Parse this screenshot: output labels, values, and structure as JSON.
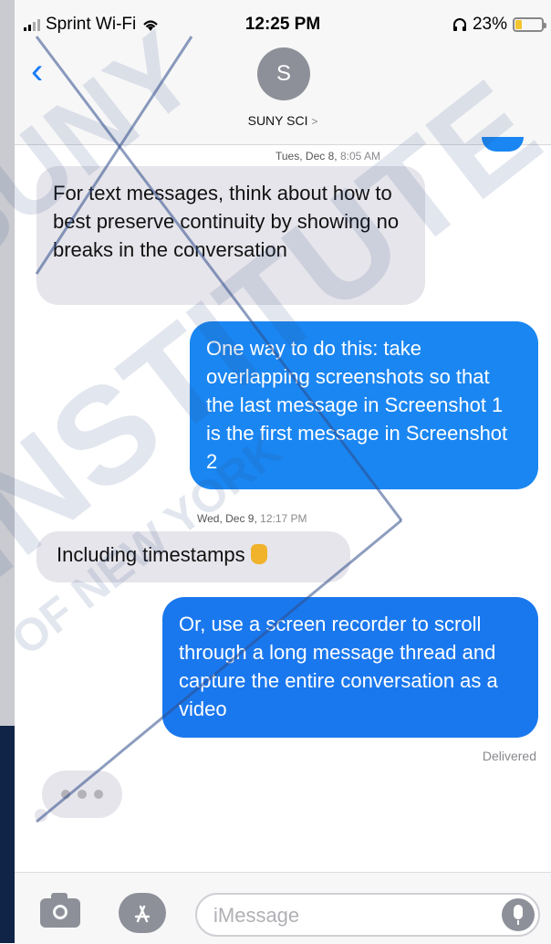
{
  "status_bar": {
    "carrier": "Sprint Wi-Fi",
    "time": "12:25 PM",
    "battery": "23%",
    "battery_level": 0.23
  },
  "header": {
    "avatar_initial": "S",
    "contact_name": "SUNY SCI",
    "chevron": ">"
  },
  "messages": [
    {
      "type": "timestamp",
      "day": "Tues, Dec 8,",
      "time": "8:05 AM"
    },
    {
      "type": "received",
      "text": "For text messages, think about how to best preserve continuity by showing no breaks in the conversation"
    },
    {
      "type": "sent",
      "text": "One way to do this: take overlapping screenshots so that the last message in Screenshot 1 is the first message in Screenshot 2"
    },
    {
      "type": "timestamp",
      "day": "Wed, Dec 9,",
      "time": "12:17 PM"
    },
    {
      "type": "received",
      "text": "Including timestamps"
    },
    {
      "type": "sent",
      "text": "Or, use a screen recorder to scroll through a long message thread and capture the entire conversation as a video"
    }
  ],
  "delivery_status": "Delivered",
  "input_bar": {
    "placeholder": "iMessage"
  },
  "watermark": [
    "SUNY",
    "INSTITUTE",
    "OF NEW YORK"
  ],
  "colors": {
    "sent_bubble": "#1a86f2",
    "received_bubble": "#e6e5eb",
    "accent": "#1a7cf5",
    "watermark": "#2f4d8a"
  },
  "icons": [
    "back-chevron-icon",
    "wifi-icon",
    "headphones-icon",
    "battery-icon",
    "camera-icon",
    "app-store-icon",
    "microphone-icon",
    "pointing-hand-emoji"
  ]
}
